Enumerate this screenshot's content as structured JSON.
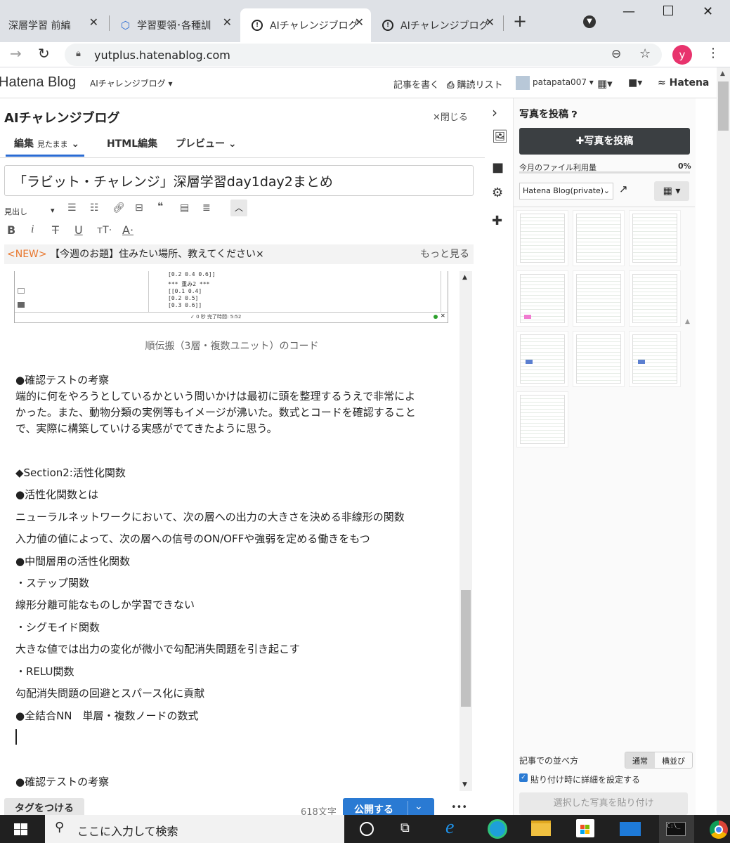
{
  "browser": {
    "tabs": [
      {
        "title": "深層学習 前編",
        "active": false
      },
      {
        "title": "学習要領･各種訓",
        "active": false
      },
      {
        "title": "AIチャレンジブログ",
        "active": true
      },
      {
        "title": "AIチャレンジブログ",
        "active": false
      }
    ],
    "new_tab": "+",
    "url": "yutplus.hatenablog.com",
    "profile_initial": "y"
  },
  "hatena_header": {
    "logo": "Hatena Blog",
    "blog_menu": "AIチャレンジブログ ▾",
    "write": "記事を書く",
    "reading_list": "購読リスト",
    "user": "patapata007 ▾",
    "brand": "Hatena"
  },
  "editor": {
    "blog_name": "AIチャレンジブログ",
    "close": "✕閉じる",
    "modes": {
      "edit": "編集",
      "edit_sub": "見たまま",
      "html": "HTML編集",
      "preview": "プレビュー"
    },
    "title": "「ラビット・チャレンジ」深層学習day1day2まとめ",
    "format_select": "見出し",
    "new_tag": "<NEW>",
    "topic": "【今週のお題】住みたい場所、教えてください×",
    "more": "もっと見る",
    "screenshot": {
      "code_lines": [
        "[0.2 0.4 0.6]]",
        "*** 重み2 ***",
        "[[0.1 0.4]",
        " [0.2 0.5]",
        " [0.3 0.6]]"
      ],
      "status": "✓ 0 秒   完了時間: 5:52"
    },
    "caption": "順伝搬（3層・複数ユニット）のコード",
    "paragraphs": [
      "●確認テストの考察",
      "端的に何をやろうとしているかという問いかけは最初に頭を整理するうえで非常によ",
      "かった。また、動物分類の実例等もイメージが沸いた。数式とコードを確認すること",
      "で、実際に構築していける実感がでてきたように思う。",
      "◆Section2:活性化関数",
      "●活性化関数とは",
      "ニューラルネットワークにおいて、次の層への出力の大きさを決める非線形の関数",
      "入力値の値によって、次の層への信号のON/OFFや強弱を定める働きをもつ",
      "●中間層用の活性化関数",
      "・ステップ関数",
      "線形分離可能なものしか学習できない",
      "・シグモイド関数",
      "大きな値では出力の変化が微小で勾配消失問題を引き起こす",
      "・RELU関数",
      "勾配消失問題の回避とスパース化に貢献",
      "●全結合NN　単層・複数ノードの数式",
      "●確認テストの考察"
    ],
    "tag_button": "タグをつける",
    "char_count": "618文字",
    "publish": "公開する",
    "more_menu": "•••"
  },
  "photo_panel": {
    "title": "写真を投稿",
    "upload": "✚写真を投稿",
    "usage_label": "今月のファイル利用量",
    "usage_value": "0%",
    "album": "Hatena Blog(private)",
    "sort_label": "記事での並べ方",
    "sort_normal": "通常",
    "sort_side": "横並び",
    "detail_checkbox": "貼り付け時に詳細を設定する",
    "paste": "選択した写真を貼り付け"
  },
  "taskbar": {
    "search_placeholder": "ここに入力して検索"
  }
}
